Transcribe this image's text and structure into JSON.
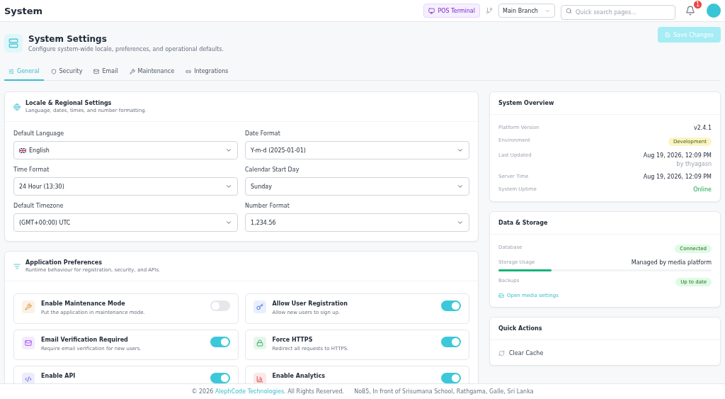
{
  "header": {
    "title": "System",
    "pos_button": "POS Terminal",
    "branch": "Main Branch",
    "search": {
      "placeholder": "Quick search pages..."
    },
    "notification_count": "1"
  },
  "page": {
    "title": "System Settings",
    "subtitle": "Configure system-wide locale, preferences, and operational defaults.",
    "save_button": {
      "label": "Save Changes",
      "disabled": true
    }
  },
  "tabs": [
    {
      "label": "General",
      "kind": "general",
      "selected": true
    },
    {
      "label": "Security",
      "kind": "security",
      "selected": false
    },
    {
      "label": "Email",
      "kind": "email",
      "selected": false
    },
    {
      "label": "Maintenance",
      "kind": "maintenance",
      "selected": false
    },
    {
      "label": "Integrations",
      "kind": "integrations",
      "selected": false
    }
  ],
  "locale": {
    "title": "Locale & Regional Settings",
    "subtitle": "Language, dates, times, and number formatting.",
    "fields": [
      {
        "label": "Default Language",
        "value": "English",
        "kind": "flag"
      },
      {
        "label": "Date Format",
        "value": "Y-m-d (2025-01-01)",
        "kind": "plain"
      },
      {
        "label": "Time Format",
        "value": "24 Hour (13:30)",
        "kind": "plain"
      },
      {
        "label": "Calendar Start Day",
        "value": "Sunday",
        "kind": "plain"
      },
      {
        "label": "Default Timezone",
        "value": "(GMT+00:00) UTC",
        "kind": "plain"
      },
      {
        "label": "Number Format",
        "value": "1,234.56",
        "kind": "plain"
      }
    ]
  },
  "preferences": {
    "title": "Application Preferences",
    "subtitle": "Runtime behaviour for registration, security, and APIs.",
    "items": [
      {
        "title": "Enable Maintenance Mode",
        "description": "Put the application in maintenance mode.",
        "kind": "maintenance",
        "on": false
      },
      {
        "title": "Allow User Registration",
        "description": "Allow new users to sign up.",
        "kind": "registration",
        "on": true
      },
      {
        "title": "Email Verification Required",
        "description": "Require email verification for new users.",
        "kind": "email",
        "on": true
      },
      {
        "title": "Force HTTPS",
        "description": "Redirect all requests to HTTPS.",
        "kind": "https",
        "on": true
      },
      {
        "title": "Enable API",
        "kind": "api",
        "on": true
      },
      {
        "title": "Enable Analytics",
        "kind": "analytics",
        "on": true
      }
    ]
  },
  "overview": {
    "title": "System Overview",
    "rows": [
      {
        "label": "Platform Version",
        "value": "v2.4.1",
        "kind": "text"
      },
      {
        "label": "Environment",
        "value": "Development",
        "kind": "badge",
        "color": "#fdf3c4"
      },
      {
        "label": "Last Updated",
        "value": "Aug 19, 2026, 12:09 PM",
        "note": "by thyagasn",
        "kind": "text"
      },
      {
        "label": "Server Time",
        "value": "Aug 19, 2026, 12:09 PM",
        "kind": "text"
      },
      {
        "label": "System Uptime",
        "value": "Online",
        "kind": "status"
      }
    ]
  },
  "storage": {
    "title": "Data & Storage",
    "rows": [
      {
        "label": "Database",
        "value": "Connected",
        "kind": "badge",
        "color": "#dcfce7"
      },
      {
        "label": "Storage Usage",
        "value": "Managed by media platform",
        "kind": "meter",
        "level": 0.25
      },
      {
        "label": "Backups",
        "value": "Up to date",
        "kind": "badge",
        "color": "#dcfce7"
      }
    ],
    "link": "Open media settings"
  },
  "quick_actions": {
    "title": "Quick Actions",
    "actions": [
      "Clear Cache"
    ]
  },
  "footer": {
    "copyright_before": "© 2026 ",
    "company": "AlephCode Technologies",
    "copyright_after": ". All Rights Reserved.",
    "address": "No85, In front of Srisumana School, Rathgama, Galle, Sri Lanka"
  }
}
